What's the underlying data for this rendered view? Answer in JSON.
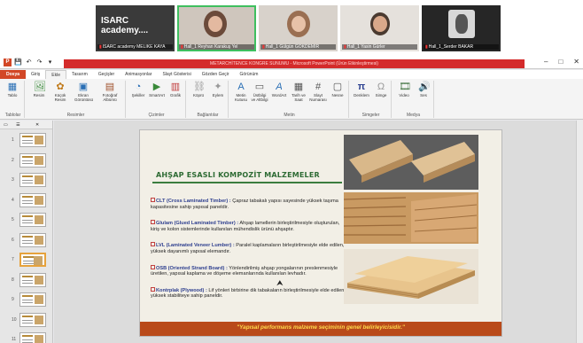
{
  "call": {
    "tiles": [
      {
        "name": "ISARC academy MELIKE KAYA",
        "label": "ISARC academy...."
      },
      {
        "name": "Hall_1 Reyhan Karakuş Yel"
      },
      {
        "name": "Hall_1 Gülgün GÖKDEMİR"
      },
      {
        "name": "Hall_1 Yasin Gürler"
      },
      {
        "name": "Hall_1_Serder BAKAR"
      }
    ]
  },
  "app": {
    "title": "METARCHİTENCE KONGRE SUNUMU - Microsoft PowerPoint (Ürün Etkinleştirmesi)",
    "ppt_logo": "P",
    "tabs": [
      "Dosya",
      "Giriş",
      "Ekle",
      "Tasarım",
      "Geçişler",
      "Animasyonlar",
      "Slayt Gösterisi",
      "Gözden Geçir",
      "Görünüm"
    ],
    "selected_tab": "Ekle"
  },
  "ribbon": {
    "groups": [
      {
        "name": "Tablolar",
        "buttons": [
          {
            "label": "Tablo",
            "icon": "table-icon"
          }
        ]
      },
      {
        "name": "Resimler",
        "buttons": [
          {
            "label": "Resim",
            "icon": "picture-icon"
          },
          {
            "label": "Küçük Resim",
            "icon": "clipart-icon"
          },
          {
            "label": "Ekran Görüntüsü",
            "icon": "screenshot-icon"
          },
          {
            "label": "Fotoğraf Albümü",
            "icon": "album-icon"
          }
        ]
      },
      {
        "name": "Çizimler",
        "buttons": [
          {
            "label": "Şekiller",
            "icon": "shapes-icon"
          },
          {
            "label": "SmartArt",
            "icon": "smartart-icon"
          },
          {
            "label": "Grafik",
            "icon": "chart-icon"
          }
        ]
      },
      {
        "name": "Bağlantılar",
        "buttons": [
          {
            "label": "Köprü",
            "icon": "hyperlink-icon"
          },
          {
            "label": "Eylem",
            "icon": "action-icon"
          }
        ]
      },
      {
        "name": "Metin",
        "buttons": [
          {
            "label": "Metin Kutusu",
            "icon": "textbox-icon"
          },
          {
            "label": "Üstbilgi ve Altbilgi",
            "icon": "header-icon"
          },
          {
            "label": "WordArt",
            "icon": "wordart-icon"
          },
          {
            "label": "Tarih ve Saat",
            "icon": "datetime-icon"
          },
          {
            "label": "Slayt Numarası",
            "icon": "slidenumber-icon"
          },
          {
            "label": "Nesne",
            "icon": "object-icon"
          }
        ]
      },
      {
        "name": "Simgeler",
        "buttons": [
          {
            "label": "Denklem",
            "icon": "pi-icon"
          },
          {
            "label": "Simge",
            "icon": "omega-icon"
          }
        ]
      },
      {
        "name": "Medya",
        "buttons": [
          {
            "label": "Video",
            "icon": "video-icon"
          },
          {
            "label": "Ses",
            "icon": "audio-icon"
          }
        ]
      }
    ]
  },
  "thumbs": {
    "numbers": [
      "1",
      "2",
      "3",
      "4",
      "5",
      "6",
      "7",
      "8",
      "9",
      "10",
      "11"
    ],
    "selected": "7"
  },
  "slide": {
    "title": "AHŞAP ESASLI KOMPOZİT MALZEMELER",
    "items": [
      {
        "lead": "CLT (Cross Laminated Timber) :",
        "text": "Çapraz tabakalı yapısı sayesinde yüksek taşıma kapasitesine sahip yapısal paneldir."
      },
      {
        "lead": "Glulam (Glued Laminated Timber) :",
        "text": "Ahşap lamellerin birleştirilmesiyle oluşturulan, kiriş ve kolon sistemlerinde kullanılan mühendislik ürünü ahşaptır."
      },
      {
        "lead": "LVL (Laminated Veneer Lumber) :",
        "text": "Paralel kaplamaların birleştirilmesiyle elde edilen, yüksek dayanımlı yapısal elemandır."
      },
      {
        "lead": "OSB (Oriented Strand Board) :",
        "text": "Yönlendirilmiş ahşap yongalarının preslenmesiyle üretilen, yapısal kaplama ve döşeme elemanlarında kullanılan levhadır."
      },
      {
        "lead": "Kontrplak (Plywood) :",
        "text": "Lif yönleri birbirine dik tabakaların birleştirilmesiyle elde edilen, yüksek stabiliteye sahip paneldir."
      }
    ],
    "footer": "\"Yapısal performans malzeme seçiminin genel belirleyicisidir.\""
  },
  "colors": {
    "accent_red": "#d42b2b",
    "ppt_orange": "#d24726",
    "title_green": "#2e6b34",
    "footer_band": "#b94a1a",
    "footer_text": "#ffd94d",
    "active_speaker": "#3fbf5f"
  }
}
